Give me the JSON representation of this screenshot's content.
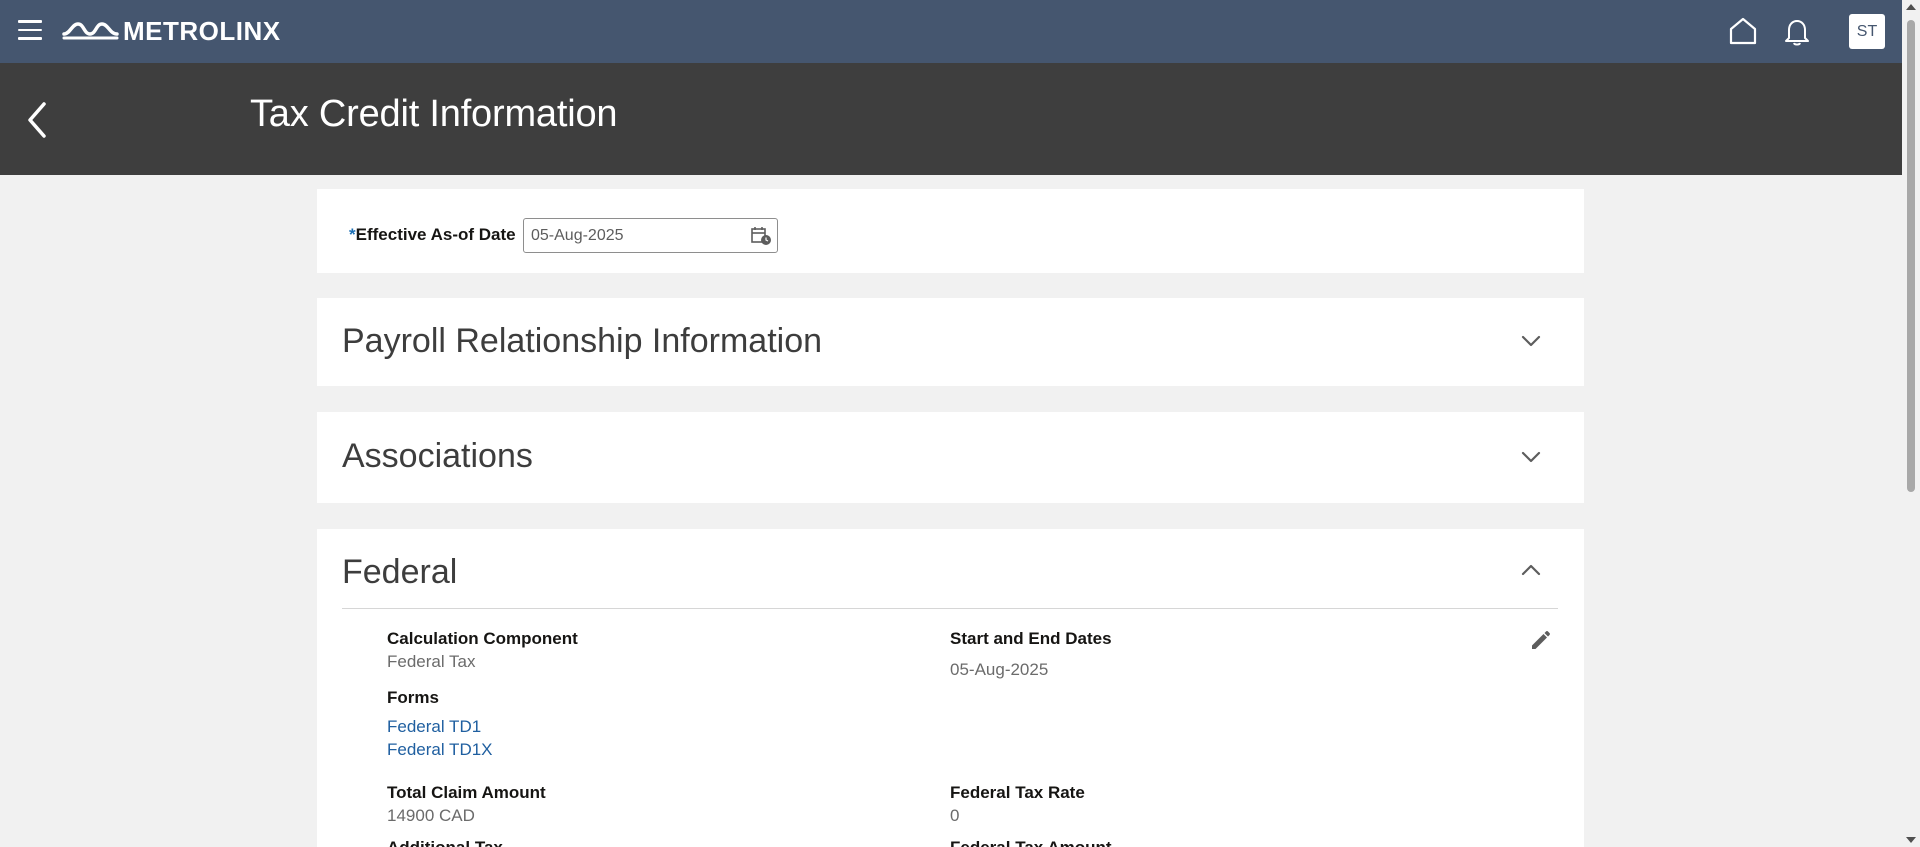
{
  "brand": {
    "name": "METROLINX"
  },
  "header": {
    "avatar_initials": "ST",
    "page_title": "Tax Credit Information"
  },
  "effective_date": {
    "label": "Effective As-of Date",
    "required_marker": "*",
    "value": "05-Aug-2025"
  },
  "sections": {
    "payroll": {
      "title": "Payroll Relationship Information",
      "expanded": false
    },
    "associations": {
      "title": "Associations",
      "expanded": false
    },
    "federal": {
      "title": "Federal",
      "expanded": true,
      "calc_component_label": "Calculation Component",
      "calc_component_value": "Federal Tax",
      "dates_label": "Start and End Dates",
      "dates_value": "05-Aug-2025",
      "forms_label": "Forms",
      "forms": [
        "Federal TD1",
        "Federal TD1X"
      ],
      "total_claim_label": "Total Claim Amount",
      "total_claim_value": "14900 CAD",
      "tax_rate_label": "Federal Tax Rate",
      "tax_rate_value": "0",
      "additional_label": "Additional Tax",
      "tax_amount_label": "Federal Tax Amount"
    }
  },
  "colors": {
    "topbar": "#45566f",
    "page_header": "#3e3e3e",
    "background": "#f1f1f1",
    "link": "#1f5fa0",
    "required": "#1b6fb5"
  },
  "icons": [
    "menu-icon",
    "metrolinx-logo-icon",
    "home-icon",
    "bell-icon",
    "back-icon",
    "calendar-icon",
    "chevron-down-icon",
    "chevron-up-icon",
    "edit-icon"
  ]
}
